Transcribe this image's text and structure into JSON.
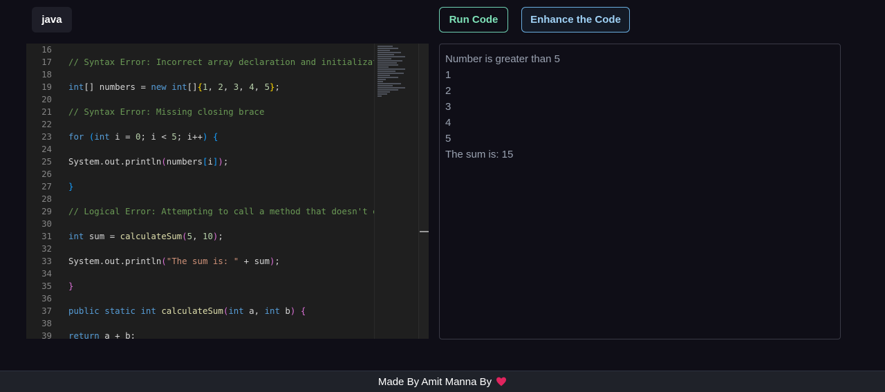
{
  "language": "java",
  "buttons": {
    "run": "Run Code",
    "enhance": "Enhance the Code"
  },
  "editor": {
    "lines": [
      {
        "n": "16",
        "t": []
      },
      {
        "n": "17",
        "t": [
          {
            "c": "cm",
            "s": "// Syntax Error: Incorrect array declaration and initializat"
          }
        ]
      },
      {
        "n": "18",
        "t": []
      },
      {
        "n": "19",
        "t": [
          {
            "c": "kw",
            "s": "int"
          },
          {
            "c": "",
            "s": "[] numbers = "
          },
          {
            "c": "kw",
            "s": "new"
          },
          {
            "c": "",
            "s": " "
          },
          {
            "c": "kw",
            "s": "int"
          },
          {
            "c": "",
            "s": "[]"
          },
          {
            "c": "b3",
            "s": "{"
          },
          {
            "c": "num",
            "s": "1"
          },
          {
            "c": "",
            "s": ", "
          },
          {
            "c": "num",
            "s": "2"
          },
          {
            "c": "",
            "s": ", "
          },
          {
            "c": "num",
            "s": "3"
          },
          {
            "c": "",
            "s": ", "
          },
          {
            "c": "num",
            "s": "4"
          },
          {
            "c": "",
            "s": ", "
          },
          {
            "c": "num",
            "s": "5"
          },
          {
            "c": "b3",
            "s": "}"
          },
          {
            "c": "",
            "s": ";"
          }
        ]
      },
      {
        "n": "20",
        "t": []
      },
      {
        "n": "21",
        "t": [
          {
            "c": "cm",
            "s": "// Syntax Error: Missing closing brace"
          }
        ]
      },
      {
        "n": "22",
        "t": []
      },
      {
        "n": "23",
        "t": [
          {
            "c": "kw",
            "s": "for"
          },
          {
            "c": "",
            "s": " "
          },
          {
            "c": "b2",
            "s": "("
          },
          {
            "c": "kw",
            "s": "int"
          },
          {
            "c": "",
            "s": " i = "
          },
          {
            "c": "num",
            "s": "0"
          },
          {
            "c": "",
            "s": "; i < "
          },
          {
            "c": "num",
            "s": "5"
          },
          {
            "c": "",
            "s": "; i++"
          },
          {
            "c": "b2",
            "s": ")"
          },
          {
            "c": "",
            "s": " "
          },
          {
            "c": "b2",
            "s": "{"
          }
        ]
      },
      {
        "n": "24",
        "t": []
      },
      {
        "n": "25",
        "t": [
          {
            "c": "",
            "s": "System.out.println"
          },
          {
            "c": "b1",
            "s": "("
          },
          {
            "c": "",
            "s": "numbers"
          },
          {
            "c": "b2",
            "s": "["
          },
          {
            "c": "",
            "s": "i"
          },
          {
            "c": "b2",
            "s": "]"
          },
          {
            "c": "b1",
            "s": ")"
          },
          {
            "c": "",
            "s": ";"
          }
        ]
      },
      {
        "n": "26",
        "t": []
      },
      {
        "n": "27",
        "t": [
          {
            "c": "b2",
            "s": "}"
          }
        ]
      },
      {
        "n": "28",
        "t": []
      },
      {
        "n": "29",
        "t": [
          {
            "c": "cm",
            "s": "// Logical Error: Attempting to call a method that doesn't e"
          }
        ]
      },
      {
        "n": "30",
        "t": []
      },
      {
        "n": "31",
        "t": [
          {
            "c": "kw",
            "s": "int"
          },
          {
            "c": "",
            "s": " sum = "
          },
          {
            "c": "fn",
            "s": "calculateSum"
          },
          {
            "c": "b1",
            "s": "("
          },
          {
            "c": "num",
            "s": "5"
          },
          {
            "c": "",
            "s": ", "
          },
          {
            "c": "num",
            "s": "10"
          },
          {
            "c": "b1",
            "s": ")"
          },
          {
            "c": "",
            "s": ";"
          }
        ]
      },
      {
        "n": "32",
        "t": []
      },
      {
        "n": "33",
        "t": [
          {
            "c": "",
            "s": "System.out.println"
          },
          {
            "c": "b1",
            "s": "("
          },
          {
            "c": "str",
            "s": "\"The sum is: \""
          },
          {
            "c": "",
            "s": " + sum"
          },
          {
            "c": "b1",
            "s": ")"
          },
          {
            "c": "",
            "s": ";"
          }
        ]
      },
      {
        "n": "34",
        "t": []
      },
      {
        "n": "35",
        "t": [
          {
            "c": "b1",
            "s": "}"
          }
        ]
      },
      {
        "n": "36",
        "t": []
      },
      {
        "n": "37",
        "t": [
          {
            "c": "kw",
            "s": "public"
          },
          {
            "c": "",
            "s": " "
          },
          {
            "c": "kw",
            "s": "static"
          },
          {
            "c": "",
            "s": " "
          },
          {
            "c": "kw",
            "s": "int"
          },
          {
            "c": "",
            "s": " "
          },
          {
            "c": "fn",
            "s": "calculateSum"
          },
          {
            "c": "b1",
            "s": "("
          },
          {
            "c": "kw",
            "s": "int"
          },
          {
            "c": "",
            "s": " a, "
          },
          {
            "c": "kw",
            "s": "int"
          },
          {
            "c": "",
            "s": " b"
          },
          {
            "c": "b1",
            "s": ")"
          },
          {
            "c": "",
            "s": " "
          },
          {
            "c": "b1",
            "s": "{"
          }
        ]
      },
      {
        "n": "38",
        "t": []
      },
      {
        "n": "39",
        "t": [
          {
            "c": "kw",
            "s": "return"
          },
          {
            "c": "",
            "s": " a + b;"
          }
        ]
      }
    ]
  },
  "output": {
    "lines": [
      "Number is greater than 5",
      "1",
      "2",
      "3",
      "4",
      "5",
      "The sum is: 15"
    ]
  },
  "footer": {
    "text": "Made By Amit Manna By",
    "icon": "heart-icon"
  },
  "colors": {
    "run_accent": "#7ee2b8",
    "enhance_accent": "#9fd1f5",
    "heart": "#e0245e"
  }
}
